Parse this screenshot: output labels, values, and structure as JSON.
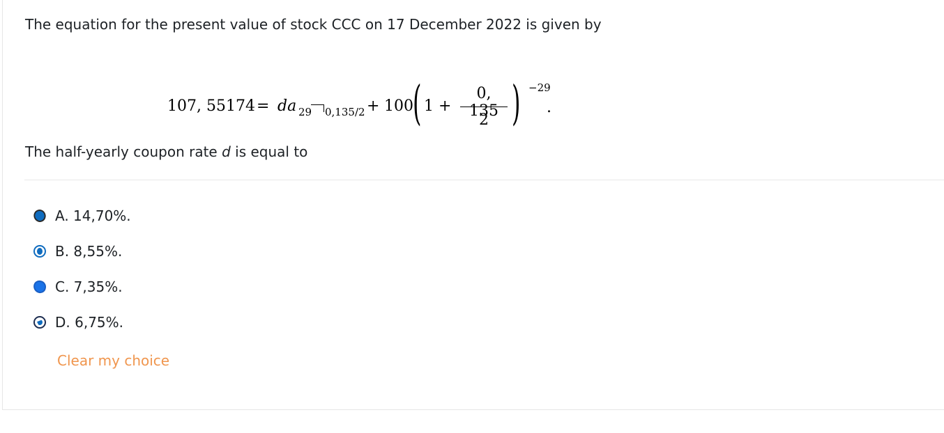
{
  "question": {
    "intro_text": "The equation for the present value of stock CCC on 17 December 2022 is given by",
    "prompt_before": "The half-yearly coupon rate ",
    "prompt_variable": "d",
    "prompt_after": " is equal to"
  },
  "equation": {
    "lhs": "107, 55174",
    "equals": "=",
    "da": "da",
    "annuity_term": "29",
    "annuity_rate": "0,135/2",
    "plus": "+",
    "hundred": "100",
    "paren_left": "(",
    "one": "1",
    "plus2": "+",
    "frac_numerator": "0, 135",
    "frac_denominator": "2",
    "paren_right": ")",
    "exponent": "−29",
    "period": "."
  },
  "options": [
    {
      "letter": "A.",
      "text": "A. 14,70%."
    },
    {
      "letter": "B.",
      "text": "B. 8,55%."
    },
    {
      "letter": "C.",
      "text": "C. 7,35%."
    },
    {
      "letter": "D.",
      "text": "D. 6,75%."
    }
  ],
  "clear_choice_label": "Clear my choice",
  "colors": {
    "accent": "#0f6cbf",
    "link": "#f0964e",
    "text": "#1d2125"
  }
}
